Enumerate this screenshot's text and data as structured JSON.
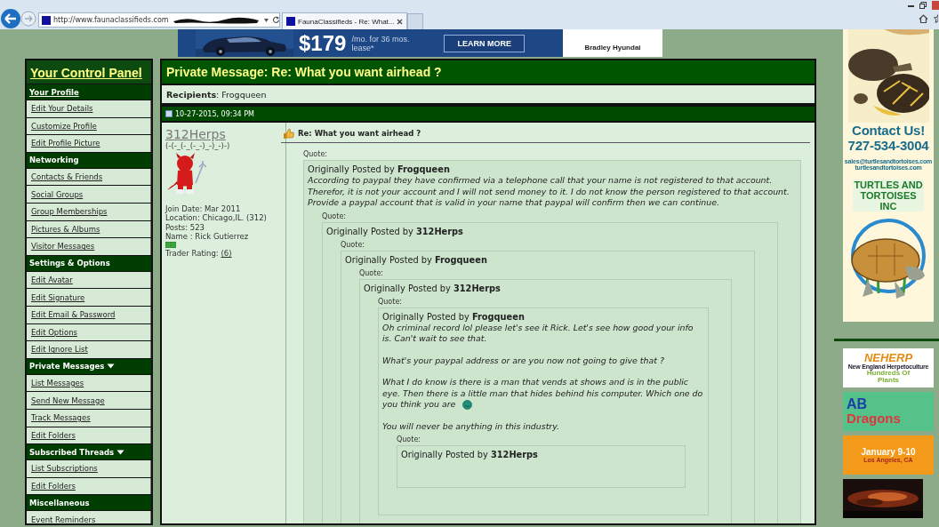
{
  "browser": {
    "url": "http://www.faunaclassifieds.com",
    "tabs": [
      {
        "title": "FaunaClassifieds - Re: What...",
        "selected": true
      }
    ]
  },
  "banner_ad": {
    "price": "$179",
    "terms": "/mo. for 36 mos. lease*",
    "button": "LEARN MORE",
    "dealer": "Bradley Hyundai"
  },
  "control_panel": {
    "title": "Your Control Panel",
    "sections": [
      {
        "title": "Your Profile",
        "link": true,
        "dropdown": false,
        "items": [
          "Edit Your Details",
          "Customize Profile",
          "Edit Profile Picture"
        ]
      },
      {
        "title": "Networking",
        "link": false,
        "dropdown": false,
        "items": [
          "Contacts & Friends",
          "Social Groups",
          "Group Memberships",
          "Pictures & Albums",
          "Visitor Messages"
        ]
      },
      {
        "title": "Settings & Options",
        "link": false,
        "dropdown": false,
        "items": [
          "Edit Avatar",
          "Edit Signature",
          "Edit Email & Password",
          "Edit Options",
          "Edit Ignore List"
        ]
      },
      {
        "title": "Private Messages",
        "link": false,
        "dropdown": true,
        "items": [
          "List Messages",
          "Send New Message",
          "Track Messages",
          "Edit Folders"
        ]
      },
      {
        "title": "Subscribed Threads",
        "link": false,
        "dropdown": true,
        "items": [
          "List Subscriptions",
          "Edit Folders"
        ]
      },
      {
        "title": "Miscellaneous",
        "link": false,
        "dropdown": false,
        "items": [
          "Event Reminders"
        ]
      }
    ]
  },
  "message": {
    "title": "Private Message: Re: What you want airhead ?",
    "recipients": "**Recipients**: Frogqueen",
    "post": {
      "date": "10-27-2015, 09:34 PM",
      "author": {
        "username": "312Herps",
        "tagline": "(-(-_(-_(-_-)_-)_-)-)",
        "stats": [
          "Join Date: Mar 2011",
          "Location: Chicago,IL. (312)",
          "Posts: 523",
          "Name : Rick Gutierrez"
        ],
        "trader_rating": {
          "label": "Trader Rating:",
          "value": "(6)"
        }
      },
      "title": "Re: What you want airhead ?",
      "quote": {
        "label": "Quote:",
        "attribution": "Originally Posted by **Frogqueen**",
        "paragraphs": [
          {
            "text": "According to paypal they have confirmed via a telephone call that your name is not registered to that account. Therefor, it is not your account and I will not send money to it. I do not know the person registered to that account. Provide a paypal account that is valid in your name that paypal will confirm then we can continue.",
            "emoticon": false
          }
        ],
        "quote": {
          "label": "Quote:",
          "attribution": "Originally Posted by **312Herps**",
          "quote": {
            "label": "Quote:",
            "attribution": "Originally Posted by **Frogqueen**",
            "quote": {
              "label": "Quote:",
              "attribution": "Originally Posted by **312Herps**",
              "quote": {
                "label": "Quote:",
                "attribution": "Originally Posted by **Frogqueen**",
                "paragraphs": [
                  {
                    "text": "Oh criminal record lol please let's see it Rick. Let's see how good your info is. Can't wait to see that.",
                    "emoticon": false
                  },
                  {
                    "text": "What's your paypal address or are you now not going to give that ?",
                    "emoticon": false
                  },
                  {
                    "text": "What I do know is there is a man that vends at shows and is in the public eye. Then there is a little man that hides behind his computer. Which one do you think you are",
                    "emoticon": true
                  },
                  {
                    "text": "You will never be anything in this industry.",
                    "emoticon": false
                  }
                ],
                "quote": {
                  "label": "Quote:",
                  "attribution": "Originally Posted by **312Herps**"
                }
              }
            }
          }
        }
      }
    }
  },
  "side_ads": {
    "turtle_ad": {
      "lines": [
        "Contact Us!",
        "727-534-3004",
        "sales@turtlesandtortoises.com",
        "turtlesandtortoises.com"
      ],
      "logo": "TURTLES AND TORTOISES INC"
    },
    "neherp_ad": {
      "brand": "NEHERP",
      "subtitle": "New England Herpetoculture",
      "slogan": "Hundreds Of Plants"
    },
    "dragons_ad": {
      "line_1": "AB",
      "line_2": "Dragons"
    },
    "event_ad": {
      "date": "January 9-10",
      "place": "Los Angeles, CA"
    }
  }
}
